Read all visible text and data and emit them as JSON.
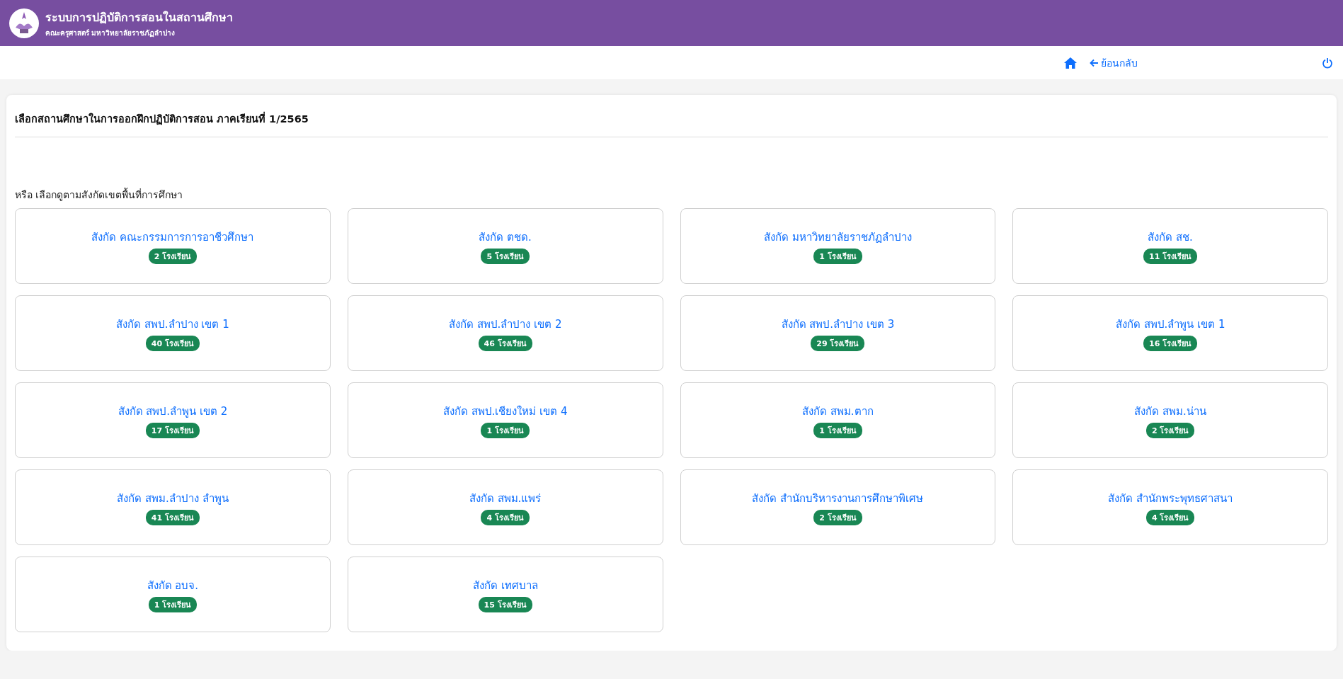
{
  "header": {
    "title": "ระบบการปฏิบัติการสอนในสถานศึกษา",
    "subtitle": "คณะครุศาสตร์ มหาวิทยาลัยราชภัฏลำปาง"
  },
  "nav": {
    "back": "ย้อนกลับ"
  },
  "panel": {
    "title": "เลือกสถานศึกษาในการออกฝึกปฏิบัติการสอน ภาคเรียนที่ 1/2565",
    "hint": "หรือ เลือกดูตามสังกัดเขตพื้นที่การศึกษา"
  },
  "agencies": [
    {
      "name": "สังกัด คณะกรรมการการอาชีวศึกษา",
      "count": "2 โรงเรียน"
    },
    {
      "name": "สังกัด ตชด.",
      "count": "5 โรงเรียน"
    },
    {
      "name": "สังกัด มหาวิทยาลัยราชภัฏลำปาง",
      "count": "1 โรงเรียน"
    },
    {
      "name": "สังกัด สช.",
      "count": "11 โรงเรียน"
    },
    {
      "name": "สังกัด สพป.ลำปาง เขต 1",
      "count": "40 โรงเรียน"
    },
    {
      "name": "สังกัด สพป.ลำปาง เขต 2",
      "count": "46 โรงเรียน"
    },
    {
      "name": "สังกัด สพป.ลำปาง เขต 3",
      "count": "29 โรงเรียน"
    },
    {
      "name": "สังกัด สพป.ลำพูน เขต 1",
      "count": "16 โรงเรียน"
    },
    {
      "name": "สังกัด สพป.ลำพูน เขต 2",
      "count": "17 โรงเรียน"
    },
    {
      "name": "สังกัด สพป.เชียงใหม่ เขต 4",
      "count": "1 โรงเรียน"
    },
    {
      "name": "สังกัด สพม.ตาก",
      "count": "1 โรงเรียน"
    },
    {
      "name": "สังกัด สพม.น่าน",
      "count": "2 โรงเรียน"
    },
    {
      "name": "สังกัด สพม.ลำปาง ลำพูน",
      "count": "41 โรงเรียน"
    },
    {
      "name": "สังกัด สพม.แพร่",
      "count": "4 โรงเรียน"
    },
    {
      "name": "สังกัด สำนักบริหารงานการศึกษาพิเศษ",
      "count": "2 โรงเรียน"
    },
    {
      "name": "สังกัด สำนักพระพุทธศาสนา",
      "count": "4 โรงเรียน"
    },
    {
      "name": "สังกัด อบจ.",
      "count": "1 โรงเรียน"
    },
    {
      "name": "สังกัด เทศบาล",
      "count": "15 โรงเรียน"
    }
  ]
}
